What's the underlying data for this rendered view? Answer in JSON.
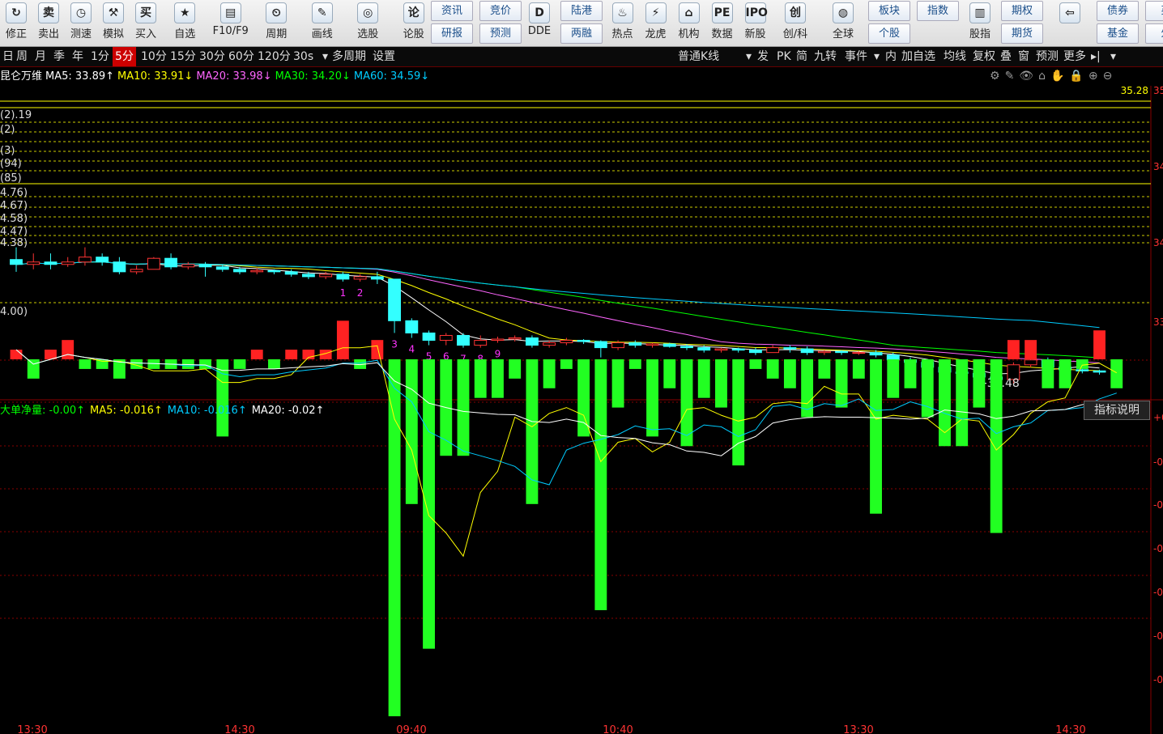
{
  "toolbar": {
    "buttons": [
      {
        "label": "修正",
        "icon": "refresh-icon",
        "glyph": "↻"
      },
      {
        "label": "卖出",
        "icon": "sell-icon",
        "glyph": "卖"
      },
      {
        "label": "测速",
        "icon": "speed-icon",
        "glyph": "◷"
      },
      {
        "label": "模拟",
        "icon": "simulate-icon",
        "glyph": "⚒"
      },
      {
        "label": "买入",
        "icon": "buy-icon",
        "glyph": "买"
      },
      {
        "label": "自选",
        "icon": "favorites-icon",
        "glyph": "★"
      },
      {
        "label": "F10/F9",
        "icon": "f10-icon",
        "glyph": "▤"
      },
      {
        "label": "周期",
        "icon": "period-icon",
        "glyph": "⏲"
      },
      {
        "label": "画线",
        "icon": "draw-line-icon",
        "glyph": "✎"
      },
      {
        "label": "选股",
        "icon": "stock-picker-icon",
        "glyph": "◎"
      },
      {
        "label": "论股",
        "icon": "discuss-icon",
        "glyph": "论"
      }
    ],
    "stacked": [
      {
        "top": "资讯",
        "bottom": "研报"
      },
      {
        "top": "竞价",
        "bottom": "预测"
      }
    ],
    "buttons2": [
      {
        "label": "DDE",
        "icon": "dde-icon",
        "glyph": "D"
      }
    ],
    "stacked2": [
      {
        "top": "陆港",
        "bottom": "两融"
      }
    ],
    "buttons3": [
      {
        "label": "热点",
        "icon": "hot-icon",
        "glyph": "♨"
      },
      {
        "label": "龙虎",
        "icon": "dragon-tiger-icon",
        "glyph": "⚡"
      },
      {
        "label": "机构",
        "icon": "institution-icon",
        "glyph": "⌂"
      },
      {
        "label": "数据",
        "icon": "data-icon",
        "glyph": "PE"
      },
      {
        "label": "新股",
        "icon": "ipo-icon",
        "glyph": "IPO"
      },
      {
        "label": "创/科",
        "icon": "chuang-icon",
        "glyph": "创"
      },
      {
        "label": "全球",
        "icon": "globe-icon",
        "glyph": "◍"
      }
    ],
    "stacked3": [
      {
        "top": "板块",
        "bottom": "个股"
      },
      {
        "top": "指数",
        "bottom": ""
      }
    ],
    "buttons4": [
      {
        "label": "股指",
        "icon": "index-futures-icon",
        "glyph": "▥"
      }
    ],
    "stacked4": [
      {
        "top": "期权",
        "bottom": "期货"
      }
    ],
    "back_icon": "arrow-left-icon",
    "stacked5": [
      {
        "top": "债券",
        "bottom": "基金"
      },
      {
        "top": "英",
        "bottom": "外"
      }
    ]
  },
  "periods": [
    "日",
    "周",
    "月",
    "季",
    "年",
    "1分",
    "5分",
    "10分",
    "15分",
    "30分",
    "60分",
    "120分",
    "30s",
    "▾",
    "多周期",
    "设置"
  ],
  "period_selected": "5分",
  "right_menu": [
    "普通K线",
    "▾",
    "发",
    "PK",
    "简",
    "九转",
    "事件",
    "▾",
    "内",
    "加自选",
    "均线",
    "复权",
    "叠",
    "窗",
    "预测",
    "更多",
    "▸|",
    "▾"
  ],
  "ma_legend": {
    "name": "昆仑万维",
    "items": [
      {
        "text": "MA5: 33.89↑",
        "color": "#ffffff"
      },
      {
        "text": "MA10: 33.91↓",
        "color": "#ffff00"
      },
      {
        "text": "MA20: 33.98↓",
        "color": "#ff66ff"
      },
      {
        "text": "MA30: 34.20↓",
        "color": "#00ff00"
      },
      {
        "text": "MA60: 34.59↓",
        "color": "#00ccff"
      }
    ]
  },
  "chart_tools": [
    "⚙",
    "✎",
    "👁",
    "⌂",
    "✋",
    "🔒",
    "⊕",
    "⊖"
  ],
  "price_chart": {
    "high_label": "35.28",
    "low_label": "←33.48",
    "left_labels": [
      "(2).19",
      "(2)",
      "(3)",
      "(94)",
      "(85)",
      "4.76)",
      "4.67)",
      "4.58)",
      "4.47)",
      "4.38)",
      "4.00)"
    ],
    "right_axis": [
      "35",
      "34",
      "34",
      "33"
    ],
    "nine_turn_top": [
      "1",
      "2"
    ],
    "nine_turn_bottom": [
      "3",
      "4",
      "5",
      "6",
      "7",
      "8",
      "9"
    ],
    "nine_turn_top2": [
      "1",
      "2",
      "3",
      "4"
    ],
    "nine_turn_bottom2": [
      "5",
      "6",
      "7",
      "8",
      "9"
    ]
  },
  "indicator": {
    "name": "大单净量",
    "items": [
      {
        "text": "大单净量: -0.00↑",
        "color": "#00ff00"
      },
      {
        "text": "MA5: -0.016↑",
        "color": "#ffff00"
      },
      {
        "text": "MA10: -0.016↑",
        "color": "#00ccff"
      },
      {
        "text": "MA20: -0.02↑",
        "color": "#ffffff"
      }
    ],
    "help_label": "指标说明",
    "right_axis": [
      "+0",
      "-0",
      "-0",
      "-0",
      "-0",
      "-0",
      "-0"
    ]
  },
  "time_axis": [
    "13:30",
    "14:30",
    "09:40",
    "10:40",
    "13:30",
    "14:30"
  ],
  "chart_data": [
    {
      "type": "candlestick",
      "title": "昆仑万维 5分",
      "candles": [
        [
          33.9,
          33.86,
          34.0,
          33.8
        ],
        [
          33.86,
          33.88,
          33.95,
          33.82
        ],
        [
          33.88,
          33.86,
          33.95,
          33.82
        ],
        [
          33.86,
          33.88,
          33.92,
          33.84
        ],
        [
          33.88,
          33.92,
          34.0,
          33.85
        ],
        [
          33.92,
          33.88,
          33.95,
          33.85
        ],
        [
          33.88,
          33.8,
          33.92,
          33.78
        ],
        [
          33.8,
          33.82,
          33.85,
          33.78
        ],
        [
          33.82,
          33.91,
          33.92,
          33.82
        ],
        [
          33.91,
          33.84,
          33.95,
          33.82
        ],
        [
          33.84,
          33.86,
          33.88,
          33.82
        ],
        [
          33.86,
          33.84,
          33.88,
          33.76
        ],
        [
          33.84,
          33.82,
          33.86,
          33.8
        ],
        [
          33.82,
          33.8,
          33.84,
          33.78
        ],
        [
          33.8,
          33.81,
          33.83,
          33.78
        ],
        [
          33.81,
          33.8,
          33.82,
          33.78
        ],
        [
          33.8,
          33.78,
          33.82,
          33.76
        ],
        [
          33.78,
          33.76,
          33.8,
          33.74
        ],
        [
          33.76,
          33.78,
          33.8,
          33.74
        ],
        [
          33.78,
          33.74,
          33.8,
          33.72
        ],
        [
          33.74,
          33.76,
          33.78,
          33.72
        ],
        [
          33.76,
          33.74,
          33.8,
          33.7
        ],
        [
          33.74,
          33.4,
          33.74,
          33.3
        ],
        [
          33.4,
          33.3,
          33.42,
          33.26
        ],
        [
          33.3,
          33.24,
          33.32,
          33.2
        ],
        [
          33.24,
          33.28,
          33.3,
          33.2
        ],
        [
          33.28,
          33.2,
          33.3,
          33.18
        ],
        [
          33.2,
          33.24,
          33.28,
          33.18
        ],
        [
          33.24,
          33.25,
          33.27,
          33.22
        ],
        [
          33.25,
          33.26,
          33.28,
          33.23
        ],
        [
          33.26,
          33.2,
          33.28,
          33.18
        ],
        [
          33.2,
          33.22,
          33.24,
          33.18
        ],
        [
          33.22,
          33.24,
          33.26,
          33.2
        ],
        [
          33.24,
          33.23,
          33.25,
          33.21
        ],
        [
          33.23,
          33.18,
          33.24,
          33.1
        ],
        [
          33.18,
          33.22,
          33.24,
          33.16
        ],
        [
          33.22,
          33.2,
          33.24,
          33.18
        ],
        [
          33.2,
          33.21,
          33.22,
          33.18
        ],
        [
          33.21,
          33.19,
          33.22,
          33.18
        ],
        [
          33.19,
          33.18,
          33.21,
          33.16
        ],
        [
          33.18,
          33.16,
          33.2,
          33.14
        ],
        [
          33.16,
          33.17,
          33.18,
          33.14
        ],
        [
          33.17,
          33.16,
          33.18,
          33.14
        ],
        [
          33.16,
          33.14,
          33.18,
          33.12
        ],
        [
          33.14,
          33.18,
          33.2,
          33.14
        ],
        [
          33.18,
          33.17,
          33.2,
          33.14
        ],
        [
          33.17,
          33.14,
          33.19,
          33.12
        ],
        [
          33.14,
          33.15,
          33.16,
          33.12
        ],
        [
          33.15,
          33.14,
          33.16,
          33.12
        ],
        [
          33.14,
          33.14,
          33.15,
          33.12
        ],
        [
          33.14,
          33.12,
          33.16,
          33.1
        ],
        [
          33.12,
          33.08,
          33.14,
          33.02
        ],
        [
          33.08,
          33.06,
          33.1,
          33.04
        ],
        [
          33.06,
          33.02,
          33.08,
          33.0
        ],
        [
          33.02,
          32.98,
          33.04,
          32.94
        ],
        [
          32.98,
          32.97,
          33.0,
          32.94
        ],
        [
          32.97,
          32.94,
          33.0,
          32.9
        ],
        [
          32.94,
          32.92,
          32.96,
          32.88
        ],
        [
          32.92,
          33.04,
          33.06,
          32.88
        ],
        [
          33.04,
          33.08,
          33.1,
          33.02
        ],
        [
          33.08,
          33.02,
          33.1,
          33.0
        ],
        [
          33.02,
          33.0,
          33.04,
          32.98
        ],
        [
          33.0,
          32.99,
          33.02,
          32.97
        ],
        [
          32.99,
          32.98,
          33.0,
          32.96
        ]
      ],
      "ylim": [
        32.86,
        35.28
      ]
    },
    {
      "type": "bar",
      "title": "大单净量",
      "values": [
        0.01,
        -0.02,
        0.01,
        0.02,
        -0.01,
        -0.01,
        -0.02,
        -0.01,
        -0.01,
        -0.01,
        -0.01,
        -0.01,
        -0.08,
        -0.01,
        0.01,
        -0.01,
        0.01,
        0.01,
        0.01,
        0.04,
        -0.01,
        0.02,
        -0.37,
        -0.15,
        -0.3,
        -0.1,
        -0.1,
        -0.04,
        -0.04,
        -0.02,
        -0.15,
        -0.03,
        -0.01,
        -0.08,
        -0.26,
        -0.05,
        -0.01,
        -0.08,
        -0.03,
        -0.09,
        -0.04,
        -0.05,
        -0.11,
        -0.01,
        -0.02,
        -0.03,
        -0.06,
        -0.02,
        -0.05,
        -0.02,
        -0.16,
        -0.04,
        -0.03,
        -0.06,
        -0.09,
        -0.09,
        -0.05,
        -0.18,
        0.02,
        0.02,
        -0.03,
        -0.03,
        -0.01,
        0.03,
        -0.03
      ],
      "ylim": [
        -0.38,
        0.04
      ]
    }
  ]
}
